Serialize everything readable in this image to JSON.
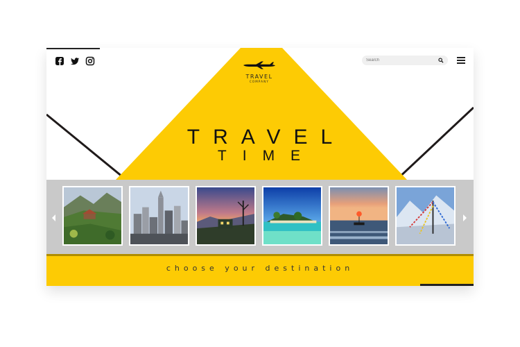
{
  "brand": {
    "title": "TRAVEL",
    "subtitle": "COMPANY",
    "icon": "airplane-icon"
  },
  "social": [
    {
      "name": "facebook",
      "icon": "facebook-icon"
    },
    {
      "name": "twitter",
      "icon": "twitter-icon"
    },
    {
      "name": "instagram",
      "icon": "instagram-icon"
    }
  ],
  "search": {
    "placeholder": "Search",
    "icon": "search-icon"
  },
  "menu": {
    "icon": "hamburger-menu-icon"
  },
  "hero": {
    "line1": "TRAVEL",
    "line2": "TIME"
  },
  "carousel": {
    "prev_icon": "chevron-left-icon",
    "next_icon": "chevron-right-icon",
    "destinations": [
      {
        "scene": "mountain village"
      },
      {
        "scene": "city skyline"
      },
      {
        "scene": "hill temple at dusk"
      },
      {
        "scene": "tropical island"
      },
      {
        "scene": "sunset boat at sea"
      },
      {
        "scene": "snowy mountain prayer flags"
      }
    ]
  },
  "tagline": "choose your destination",
  "colors": {
    "accent": "#fdcb04",
    "dark": "#1f1a1a",
    "strip": "#c9c9c9"
  }
}
